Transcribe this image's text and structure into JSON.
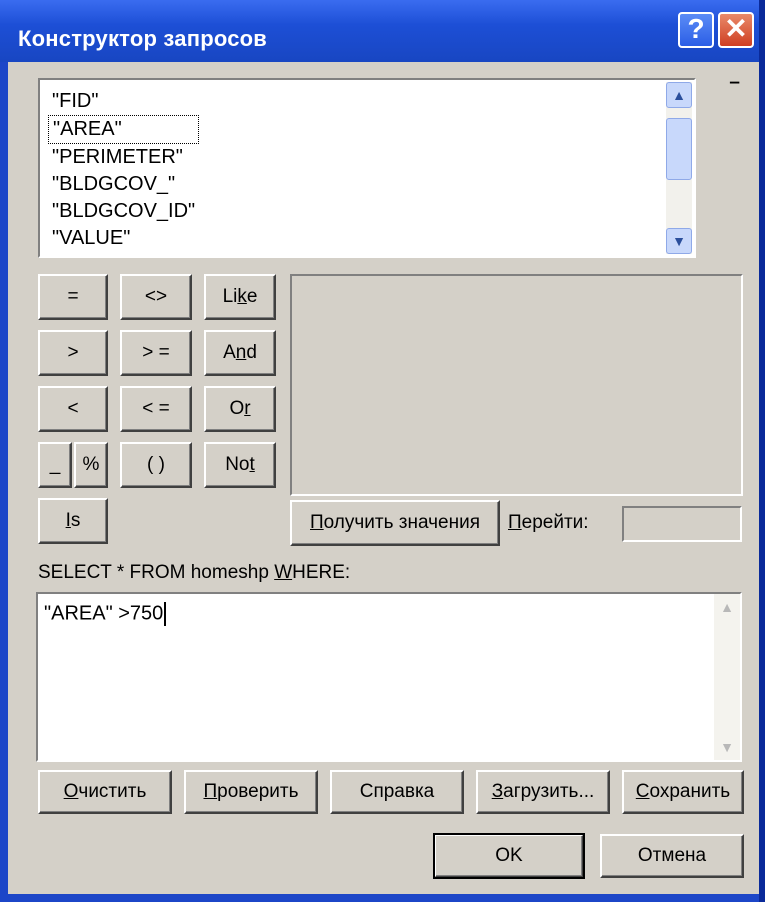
{
  "window": {
    "title": "Конструктор запросов",
    "help_glyph": "?",
    "close_glyph": "✕"
  },
  "fields": {
    "items": [
      "\"FID\"",
      "\"AREA\"",
      "\"PERIMETER\"",
      "\"BLDGCOV_\"",
      "\"BLDGCOV_ID\"",
      "\"VALUE\""
    ],
    "selected_index": 1
  },
  "operators": {
    "eq": "=",
    "ne": "<>",
    "like_pre": "Li",
    "like_ul": "k",
    "like_post": "e",
    "gt": ">",
    "ge": "> =",
    "and_pre": "A",
    "and_ul": "n",
    "and_post": "d",
    "lt": "<",
    "le": "< =",
    "or_pre": "O",
    "or_ul": "r",
    "underscore": "_",
    "percent": "%",
    "parens": "( )",
    "not_pre": "No",
    "not_ul": "t",
    "is_ul": "I",
    "is_post": "s"
  },
  "values": {
    "get_values_ul": "П",
    "get_values_post": "олучить значения",
    "goto_ul": "П",
    "goto_post": "ерейти:"
  },
  "query": {
    "prefix": "SELECT * FROM homeshp ",
    "where_ul": "W",
    "where_post": "HERE:",
    "text": "\"AREA\" >750"
  },
  "actions": {
    "clear_ul": "О",
    "clear_post": "чистить",
    "verify_ul": "П",
    "verify_post": "роверить",
    "help": "Справка",
    "load_ul": "З",
    "load_post": "агрузить...",
    "save_ul": "С",
    "save_post": "охранить",
    "ok": "OK",
    "cancel": "Отмена"
  },
  "scroll_icons": {
    "up": "▲",
    "down": "▼"
  },
  "colors": {
    "titlebar": "#1d4fd6",
    "face": "#d4d0c8",
    "close": "#cf3f22"
  }
}
